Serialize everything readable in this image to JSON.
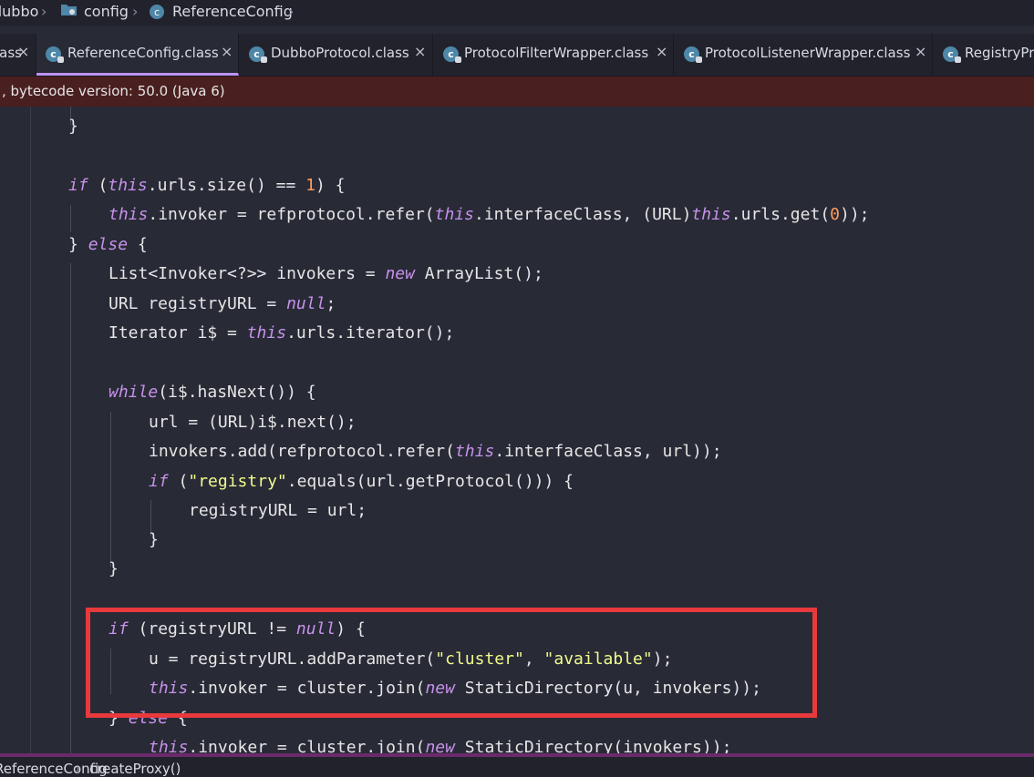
{
  "breadcrumb": {
    "items": [
      "dubbo",
      "config",
      "ReferenceConfig"
    ],
    "separator": ">"
  },
  "tabs": [
    {
      "label": "lass",
      "active": false
    },
    {
      "label": "ReferenceConfig.class",
      "active": true
    },
    {
      "label": "DubboProtocol.class",
      "active": false
    },
    {
      "label": "ProtocolFilterWrapper.class",
      "active": false
    },
    {
      "label": "ProtocolListenerWrapper.class",
      "active": false
    },
    {
      "label": "RegistryPr",
      "active": false
    }
  ],
  "tab_close_glyph": "×",
  "banner": {
    "text": ", bytecode version: 50.0 (Java 6)"
  },
  "code": {
    "lines": [
      "}",
      "",
      "if (this.urls.size() == 1) {",
      "this.invoker = refprotocol.refer(this.interfaceClass, (URL)this.urls.get(0));",
      "} else {",
      "List<Invoker<?>> invokers = new ArrayList();",
      "URL registryURL = null;",
      "Iterator i$ = this.urls.iterator();",
      "",
      "while(i$.hasNext()) {",
      "url = (URL)i$.next();",
      "invokers.add(refprotocol.refer(this.interfaceClass, url));",
      "if (\"registry\".equals(url.getProtocol())) {",
      "registryURL = url;",
      "}",
      "}",
      "",
      "if (registryURL != null) {",
      "u = registryURL.addParameter(\"cluster\", \"available\");",
      "this.invoker = cluster.join(new StaticDirectory(u, invokers));",
      "} else {",
      "this.invoker = cluster.join(new StaticDirectory(invokers));"
    ]
  },
  "status_bar": {
    "class_crumb": "ReferenceConfig",
    "method_crumb": "createProxy()"
  },
  "colors": {
    "highlight_box": "#e8393c",
    "keyword": "#c792ea",
    "string": "#f1fa8c",
    "number": "#ff9d5c",
    "background": "#282a36"
  }
}
